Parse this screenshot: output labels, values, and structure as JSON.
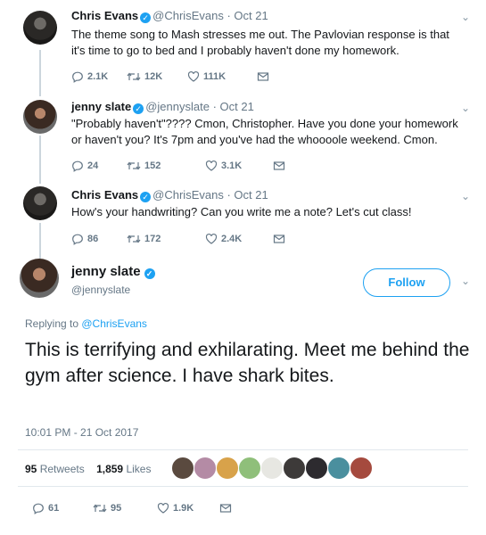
{
  "tweets": [
    {
      "name": "Chris Evans",
      "handle": "@ChrisEvans",
      "date": "Oct 21",
      "text": "The theme song to Mash stresses me out. The Pavlovian response is that it's time to go to bed and I probably haven't done my homework.",
      "replies": "2.1K",
      "retweets": "12K",
      "likes": "111K"
    },
    {
      "name": "jenny slate",
      "handle": "@jennyslate",
      "date": "Oct 21",
      "text": "\"Probably haven't\"???? Cmon, Christopher. Have you done your homework or haven't you? It's 7pm and you've had the whoooole weekend. Cmon.",
      "replies": "24",
      "retweets": "152",
      "likes": "3.1K"
    },
    {
      "name": "Chris Evans",
      "handle": "@ChrisEvans",
      "date": "Oct 21",
      "text": "How's your handwriting? Can you write me a note? Let's cut class!",
      "replies": "86",
      "retweets": "172",
      "likes": "2.4K"
    }
  ],
  "main": {
    "name": "jenny slate",
    "handle": "@jennyslate",
    "follow_label": "Follow",
    "replying_prefix": "Replying to ",
    "replying_handle": "@ChrisEvans",
    "text": "This is terrifying and exhilarating. Meet me behind the gym after science. I have shark bites.",
    "timestamp": "10:01 PM - 21 Oct 2017",
    "retweets_count": "95",
    "retweets_label": "Retweets",
    "likes_count": "1,859",
    "likes_label": "Likes",
    "replies": "61",
    "retweets": "95",
    "likes": "1.9K"
  },
  "icons": {
    "reply": "reply-icon",
    "retweet": "retweet-icon",
    "like": "heart-icon",
    "dm": "envelope-icon",
    "more": "chevron-down-icon",
    "verified": "verified-badge-icon"
  },
  "colors": {
    "accent": "#1da1f2",
    "muted": "#657786",
    "text": "#14171a"
  }
}
